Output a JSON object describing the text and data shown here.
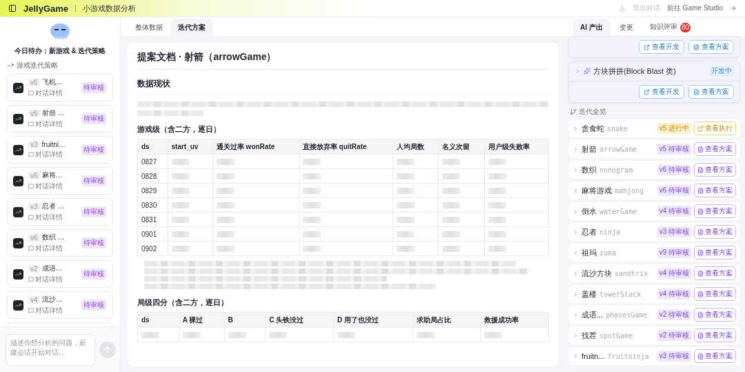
{
  "header": {
    "brand": "JellyGame",
    "subtitle": "小游戏数据分析",
    "export": "导出对话",
    "studio": "前往 Game Studio"
  },
  "sidebar": {
    "todo": "今日待办：新游戏 & 迭代策略",
    "section": "游戏迭代策略",
    "items": [
      {
        "version": "v6",
        "title": "飞机…",
        "detail": "对话详情",
        "badge": "待审核"
      },
      {
        "version": "v5",
        "title": "射箭 …",
        "detail": "对话详情",
        "badge": "待审核"
      },
      {
        "version": "v3",
        "title": "fruitni…",
        "detail": "对话详情",
        "badge": "待审核"
      },
      {
        "version": "v6",
        "title": "麻将…",
        "detail": "对话详情",
        "badge": "待审核"
      },
      {
        "version": "v3",
        "title": "忍者 …",
        "detail": "对话详情",
        "badge": "待审核"
      },
      {
        "version": "v6",
        "title": "数织 …",
        "detail": "对话详情",
        "badge": "待审核"
      },
      {
        "version": "v2",
        "title": "成语…",
        "detail": "对话详情",
        "badge": "待审核"
      },
      {
        "version": "v4",
        "title": "流沙…",
        "detail": "对话详情",
        "badge": "待审核"
      }
    ],
    "input": {
      "placeholder": "描述你想分析的问题，新建会话开始对话..."
    }
  },
  "main_tabs": [
    {
      "label": "整体数据",
      "selected": false
    },
    {
      "label": "迭代方案",
      "selected": true
    }
  ],
  "doc": {
    "title": "提案文档 · 射箭（arrowGame）",
    "section": "数据现状",
    "table1": {
      "title": "游戏级（含二方，逐日）",
      "columns": [
        "ds",
        "start_uv",
        "通关过率 wonRate",
        "直接放弃率 quitRate",
        "人均局数",
        "名义次留",
        "用户级失败率"
      ],
      "rows": [
        "0827",
        "0828",
        "0829",
        "0830",
        "0831",
        "0901",
        "0902"
      ]
    },
    "table2": {
      "title": "局级四分（含二方，逐日）",
      "columns": [
        "ds",
        "A 裸过",
        "B",
        "C 头铁没过",
        "D 用了也没过",
        "求助局占比",
        "救援成功率"
      ]
    }
  },
  "right_tabs": [
    {
      "label": "AI 产出",
      "selected": true
    },
    {
      "label": "变更",
      "selected": false
    },
    {
      "label": "知识评审",
      "selected": false,
      "count": "80"
    }
  ],
  "products": [
    {
      "buttons": [
        "查看开发",
        "查看方案"
      ]
    },
    {
      "title": "方块拼拼(Block Blast 类)",
      "status": "开发中",
      "buttons": [
        "查看开发",
        "查看方案"
      ]
    }
  ],
  "overview": {
    "title": "迭代全览",
    "items": [
      {
        "name": "贪食蛇",
        "code": "snake",
        "badge": "v5 进行中",
        "kind": "running",
        "action": "查看执行"
      },
      {
        "name": "射箭",
        "code": "arrowGame",
        "badge": "v5 待审核",
        "kind": "review",
        "action": "查看方案"
      },
      {
        "name": "数织",
        "code": "nonogram",
        "badge": "v6 待审核",
        "kind": "review",
        "action": "查看方案"
      },
      {
        "name": "麻将游戏",
        "code": "mahjong",
        "badge": "v6 待审核",
        "kind": "review",
        "action": "查看方案"
      },
      {
        "name": "倒水",
        "code": "waterGame",
        "badge": "v4 待审核",
        "kind": "review",
        "action": "查看方案"
      },
      {
        "name": "忍者",
        "code": "ninja",
        "badge": "v3 待审核",
        "kind": "review",
        "action": "查看方案"
      },
      {
        "name": "祖玛",
        "code": "zuma",
        "badge": "v9 待审核",
        "kind": "review",
        "action": "查看方案"
      },
      {
        "name": "流沙方块",
        "code": "sandtrix",
        "badge": "v4 待审核",
        "kind": "review",
        "action": "查看方案"
      },
      {
        "name": "盖楼",
        "code": "towerStack",
        "badge": "v4 待审核",
        "kind": "review",
        "action": "查看方案"
      },
      {
        "name": "成语...",
        "code": "phasesGame",
        "badge": "v2 待审核",
        "kind": "review",
        "action": "查看方案"
      },
      {
        "name": "找茬",
        "code": "spotGame",
        "badge": "v2 待审核",
        "kind": "review",
        "action": "查看方案"
      },
      {
        "name": "fruitn...",
        "code": "fruitninja",
        "badge": "v3 待审核",
        "kind": "review",
        "action": "查看方案"
      }
    ]
  }
}
